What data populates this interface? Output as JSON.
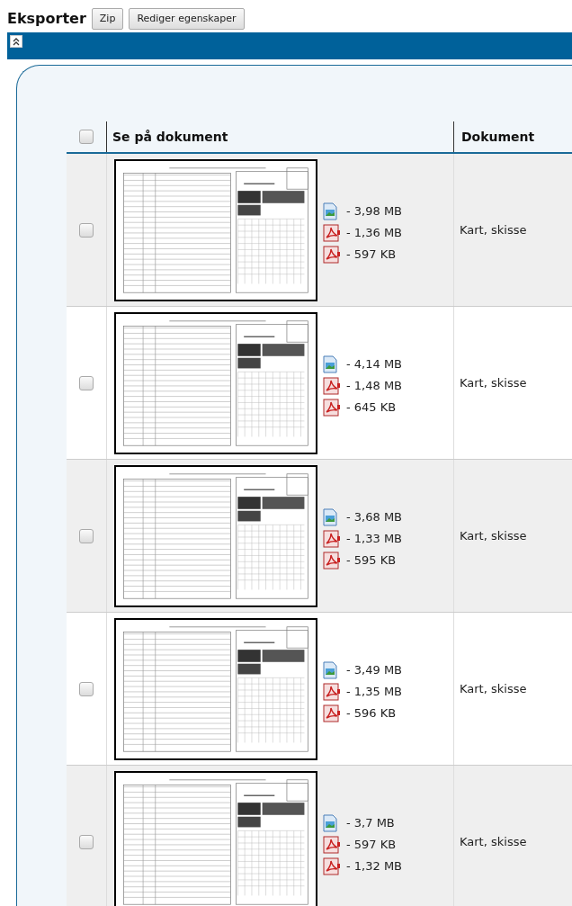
{
  "toolbar": {
    "title": "Eksporter",
    "buttons": [
      "Zip",
      "Rediger egenskaper"
    ]
  },
  "collapse_bar": {
    "expanded": true
  },
  "table": {
    "header": {
      "checked": false,
      "columns": [
        "Se på dokument",
        "Dokument"
      ]
    },
    "rows": [
      {
        "checked": false,
        "files": [
          {
            "kind": "image",
            "size": "- 3,98 MB"
          },
          {
            "kind": "pdf",
            "size": "- 1,36 MB"
          },
          {
            "kind": "pdf",
            "size": "- 597 KB"
          }
        ],
        "document_type": "Kart, skisse"
      },
      {
        "checked": false,
        "files": [
          {
            "kind": "image",
            "size": "- 4,14 MB"
          },
          {
            "kind": "pdf",
            "size": "- 1,48 MB"
          },
          {
            "kind": "pdf",
            "size": "- 645 KB"
          }
        ],
        "document_type": "Kart, skisse"
      },
      {
        "checked": false,
        "files": [
          {
            "kind": "image",
            "size": "- 3,68 MB"
          },
          {
            "kind": "pdf",
            "size": "- 1,33 MB"
          },
          {
            "kind": "pdf",
            "size": "- 595 KB"
          }
        ],
        "document_type": "Kart, skisse"
      },
      {
        "checked": false,
        "files": [
          {
            "kind": "image",
            "size": "- 3,49 MB"
          },
          {
            "kind": "pdf",
            "size": "- 1,35 MB"
          },
          {
            "kind": "pdf",
            "size": "- 596 KB"
          }
        ],
        "document_type": "Kart, skisse"
      },
      {
        "checked": false,
        "files": [
          {
            "kind": "image",
            "size": "- 3,7 MB"
          },
          {
            "kind": "pdf",
            "size": "- 597 KB"
          },
          {
            "kind": "pdf",
            "size": "- 1,32 MB"
          }
        ],
        "document_type": "Kart, skisse"
      }
    ]
  }
}
